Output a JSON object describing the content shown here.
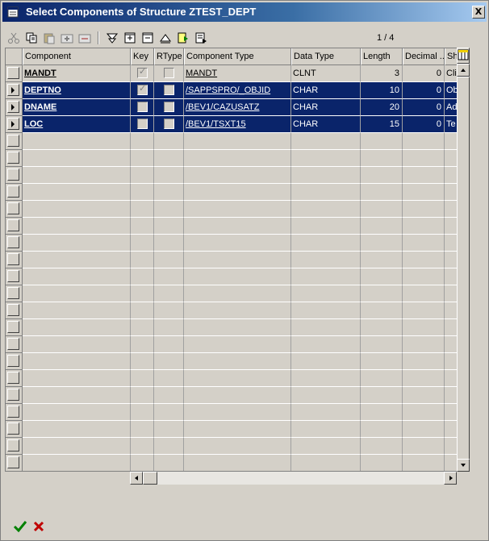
{
  "window": {
    "title": "Select Components of Structure ZTEST_DEPT",
    "close_label": "X"
  },
  "toolbar": {
    "buttons": [
      {
        "name": "cut-icon"
      },
      {
        "name": "copy-icon"
      },
      {
        "name": "paste-icon"
      },
      {
        "name": "insert-row-icon"
      },
      {
        "name": "delete-row-icon"
      },
      {
        "name": "filter-icon"
      },
      {
        "name": "expand-icon"
      },
      {
        "name": "collapse-icon"
      },
      {
        "name": "scroll-up-icon"
      },
      {
        "name": "export-icon"
      },
      {
        "name": "print-icon"
      }
    ],
    "pager": "1 / 4"
  },
  "table": {
    "headers": [
      "Component",
      "Key",
      "RType",
      "Component Type",
      "Data Type",
      "Length",
      "Decimal ...",
      "Sh"
    ],
    "rows": [
      {
        "component": "MANDT",
        "key": true,
        "rtype": false,
        "component_type": "MANDT",
        "data_type": "CLNT",
        "length": "3",
        "decimal": "0",
        "short": "Cli",
        "selected": false
      },
      {
        "component": "DEPTNO",
        "key": true,
        "rtype": false,
        "component_type": "/SAPPSPRO/_OBJID",
        "data_type": "CHAR",
        "length": "10",
        "decimal": "0",
        "short": "Ob",
        "selected": true
      },
      {
        "component": "DNAME",
        "key": false,
        "rtype": false,
        "component_type": "/BEV1/CAZUSATZ",
        "data_type": "CHAR",
        "length": "20",
        "decimal": "0",
        "short": "Ad",
        "selected": true
      },
      {
        "component": "LOC",
        "key": false,
        "rtype": false,
        "component_type": "/BEV1/TSXT15",
        "data_type": "CHAR",
        "length": "15",
        "decimal": "0",
        "short": "Te",
        "selected": true
      }
    ]
  },
  "footer": {
    "ok_icon": "check-icon",
    "cancel_icon": "cancel-icon"
  },
  "colors": {
    "selection": "#0a246a",
    "title_start": "#0a246a",
    "title_end": "#a6caf0",
    "background": "#d4d0c8"
  }
}
